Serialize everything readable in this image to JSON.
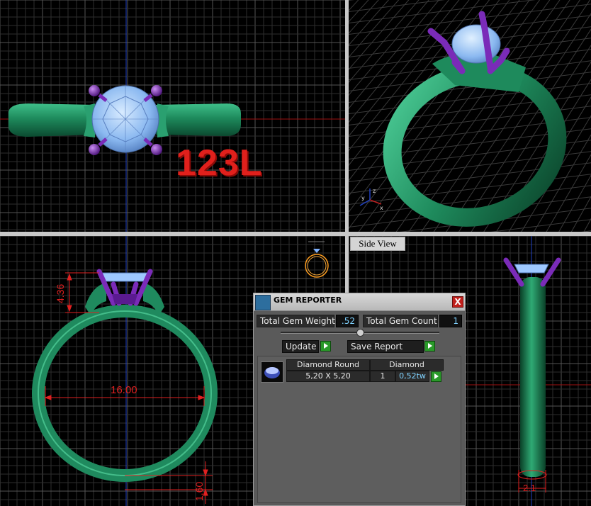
{
  "viewports": {
    "top_label": "123L",
    "side_view_label": "Side View"
  },
  "dimensions": {
    "prong_height": "4.36",
    "inner_diameter": "16.00",
    "shank_thickness": "1.60",
    "shank_width": "2.1"
  },
  "gem_reporter": {
    "title": "GEM REPORTER",
    "close_label": "X",
    "total_weight_label": "Total Gem Weight",
    "total_weight_value": ".52",
    "total_count_label": "Total Gem Count",
    "total_count_value": "1",
    "update_label": "Update",
    "save_report_label": "Save Report",
    "gems": [
      {
        "shape": "Diamond Round",
        "size": "5,20 X 5,20",
        "material": "Diamond",
        "count": "1",
        "weight": "0,52tw"
      }
    ]
  },
  "colors": {
    "metal": "#1f8a5e",
    "prong": "#7a2bb8",
    "gem": "#9ec8ff",
    "dimension": "#e02020",
    "grid_axis": "#2040c0"
  }
}
